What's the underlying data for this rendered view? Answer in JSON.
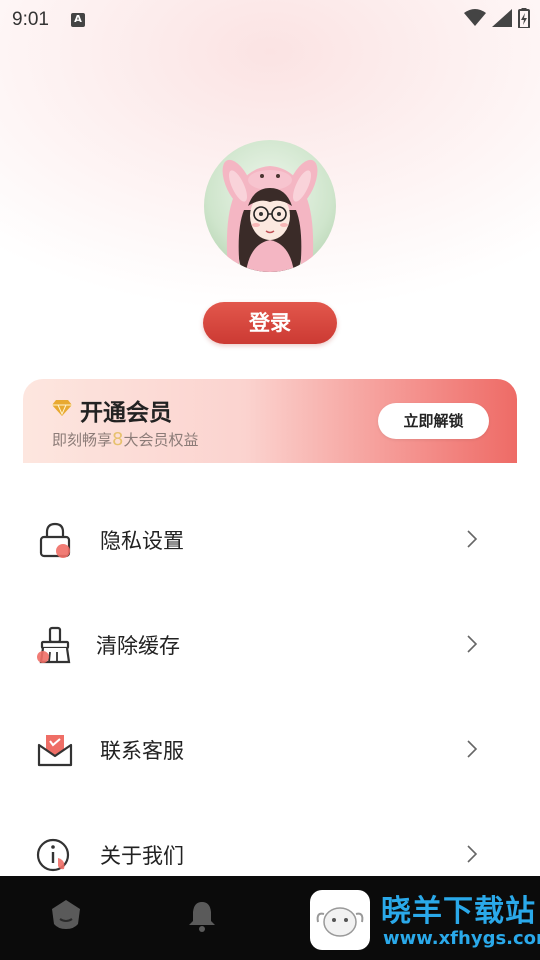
{
  "status_bar": {
    "time": "9:01",
    "notification_icon": "a-box-icon",
    "icons": [
      "wifi-icon",
      "signal-icon",
      "battery-icon"
    ]
  },
  "profile": {
    "avatar_icon": "girl-with-bunny-hood-avatar",
    "login_label": "登录"
  },
  "vip": {
    "icon": "diamond-icon",
    "title": "开通会员",
    "subtitle_prefix": "即刻畅享",
    "subtitle_number": "8",
    "subtitle_suffix": "大会员权益",
    "unlock_label": "立即解锁"
  },
  "menu": {
    "items": [
      {
        "label": "隐私设置",
        "icon": "lock-icon"
      },
      {
        "label": "清除缓存",
        "icon": "broom-icon"
      },
      {
        "label": "联系客服",
        "icon": "envelope-icon"
      },
      {
        "label": "关于我们",
        "icon": "info-icon"
      }
    ]
  },
  "bottom_nav": {
    "icons": [
      "home-icon",
      "bell-icon"
    ]
  },
  "watermark": {
    "brand": "晓羊下载站",
    "url": "www.xfhygs.com"
  },
  "colors": {
    "accent": "#d4433a",
    "vip_number": "#e7c16e",
    "watermark": "#2aa9ea"
  }
}
